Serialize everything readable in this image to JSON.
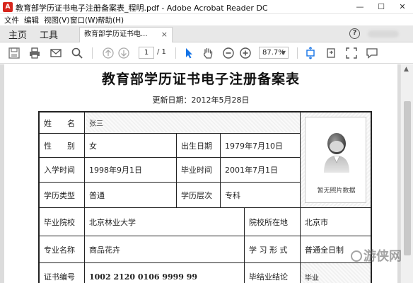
{
  "window": {
    "app_icon_letter": "A",
    "title": "教育部学历证书电子注册备案表_程明.pdf - Adobe Acrobat Reader DC",
    "minimize_glyph": "—",
    "maximize_glyph": "☐",
    "close_glyph": "✕"
  },
  "menu": [
    "文件",
    "编辑",
    "视图(V)",
    "窗口(W)",
    "帮助(H)"
  ],
  "nav_tabs": {
    "home": "主页",
    "tools": "工具"
  },
  "doc_tab": {
    "label": "教育部学历证书电...",
    "close": "×"
  },
  "toolbar": {
    "page_current": "1",
    "page_total": "/ 1",
    "zoom": "87.7%",
    "zoom_arrow": "▼"
  },
  "document": {
    "title": "教育部学历证书电子注册备案表",
    "updated": "更新日期：2012年5月28日",
    "photo_caption": "暂无照片数据",
    "fields": {
      "name_label": "姓　　名",
      "name_value": "张三",
      "gender_label": "性　　别",
      "gender_value": "女",
      "birth_label": "出生日期",
      "birth_value": "1979年7月10日",
      "enroll_label": "入学时间",
      "enroll_value": "1998年9月1日",
      "graduate_label": "毕业时间",
      "graduate_value": "2001年7月1日",
      "type_label": "学历类型",
      "type_value": "普通",
      "level_label": "学历层次",
      "level_value": "专科",
      "school_label": "毕业院校",
      "school_value": "北京林业大学",
      "location_label": "院校所在地",
      "location_value": "北京市",
      "major_label": "专业名称",
      "major_value": "商品花卉",
      "form_label": "学 习 形 式",
      "form_value": "普通全日制",
      "cert_label": "证书编号",
      "cert_value": "1002 2120 0106 9999 99",
      "conclusion_label": "毕结业结论",
      "conclusion_value": "毕业"
    }
  },
  "watermark": "游侠网",
  "icons": {
    "save": "save-icon",
    "print": "print-icon",
    "email": "email-icon",
    "search": "search-icon",
    "prev": "arrow-up-icon",
    "next": "arrow-down-icon",
    "select": "cursor-icon",
    "hand": "hand-icon",
    "zoom_out": "zoom-out-icon",
    "zoom_in": "zoom-in-icon",
    "fit": "fit-page-icon",
    "rotate": "rotate-icon",
    "fullscreen": "fullscreen-icon",
    "comment": "comment-icon",
    "help": "help-icon"
  },
  "colors": {
    "accent": "#1473e6",
    "app_red": "#d7261d"
  }
}
